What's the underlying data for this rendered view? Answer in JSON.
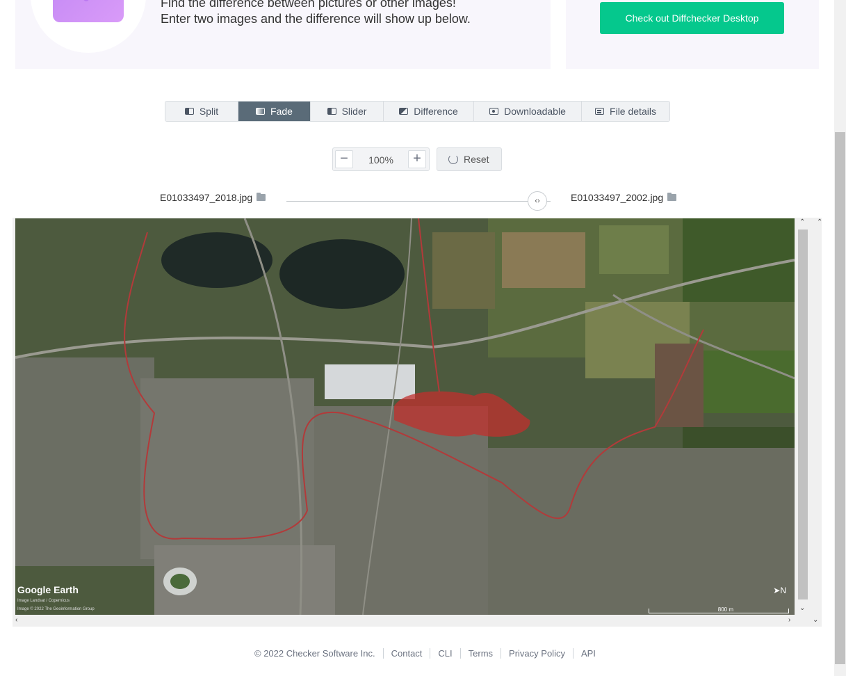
{
  "hero": {
    "line1": "Find the difference between pictures or other images!",
    "line2": "Enter two images and the difference will show up below."
  },
  "promo": {
    "button_label": "Check out Diffchecker Desktop"
  },
  "tabs": [
    {
      "label": "Split",
      "icon": "split-icon"
    },
    {
      "label": "Fade",
      "icon": "fade-icon",
      "active": true
    },
    {
      "label": "Slider",
      "icon": "slider-icon"
    },
    {
      "label": "Difference",
      "icon": "difference-icon"
    },
    {
      "label": "Downloadable",
      "icon": "download-icon"
    },
    {
      "label": "File details",
      "icon": "file-details-icon"
    }
  ],
  "zoom": {
    "value": "100%",
    "minus": "−",
    "plus": "+"
  },
  "reset": {
    "label": "Reset"
  },
  "files": {
    "left": "E01033497_2018.jpg",
    "right": "E01033497_2002.jpg"
  },
  "slider": {
    "handle": "‹›"
  },
  "image": {
    "logo": "Google Earth",
    "credit1": "Image Landsat / Copernicus",
    "credit2": "Image © 2022 The Geoinformation Group",
    "scale": "800 m"
  },
  "footer": {
    "copyright": "© 2022 Checker Software Inc.",
    "links": [
      "Contact",
      "CLI",
      "Terms",
      "Privacy Policy",
      "API"
    ]
  },
  "colors": {
    "accent_green": "#05c88d",
    "active_tab": "#5a6b78",
    "hero_bg": "#f8f6fc"
  }
}
